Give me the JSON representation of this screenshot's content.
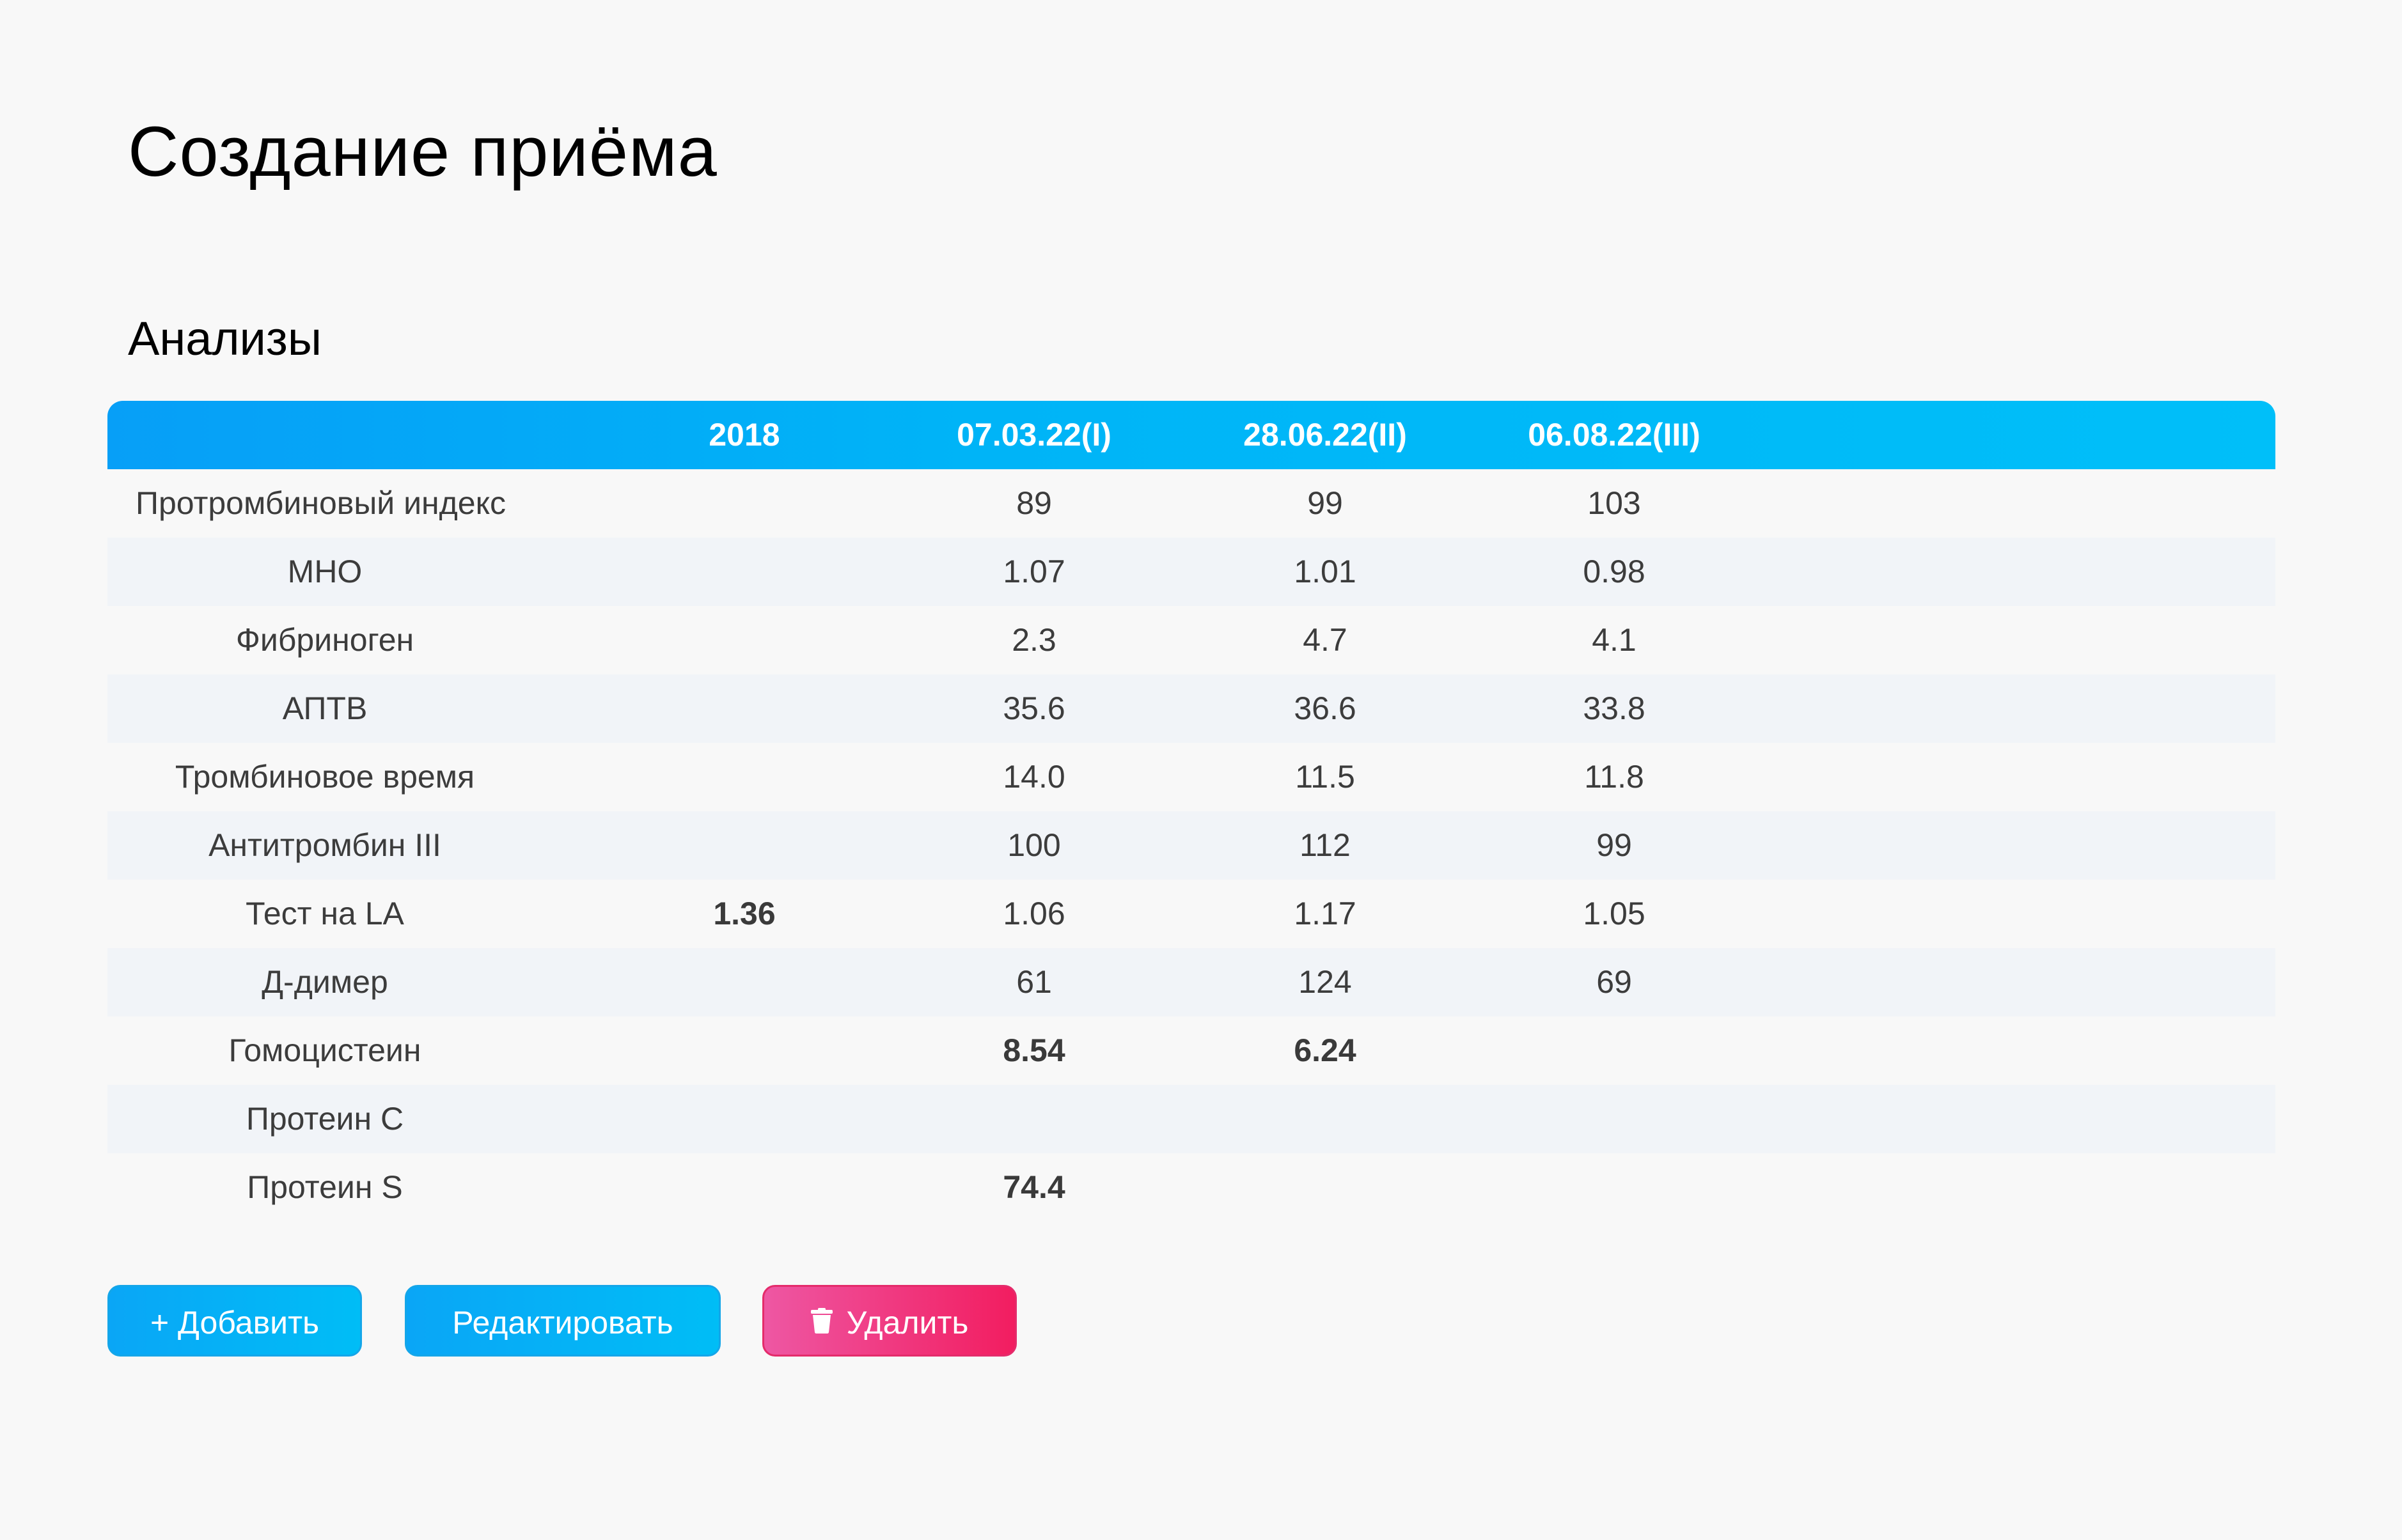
{
  "page": {
    "title": "Создание приёма"
  },
  "section": {
    "title": "Анализы"
  },
  "table": {
    "headers": [
      "",
      "2018",
      "07.03.22(I)",
      "28.06.22(II)",
      "06.08.22(III)"
    ],
    "rows": [
      {
        "name": "Протромбиновый индекс",
        "values": [
          "",
          "89",
          "99",
          "103"
        ]
      },
      {
        "name": "МНО",
        "values": [
          "",
          "1.07",
          "1.01",
          "0.98"
        ]
      },
      {
        "name": "Фибриноген",
        "values": [
          "",
          "2.3",
          "4.7",
          "4.1"
        ]
      },
      {
        "name": "АПТВ",
        "values": [
          "",
          "35.6",
          "36.6",
          "33.8"
        ]
      },
      {
        "name": "Тромбиновое время",
        "values": [
          "",
          "14.0",
          "11.5",
          "11.8"
        ]
      },
      {
        "name": "Антитромбин III",
        "values": [
          "",
          "100",
          "112",
          "99"
        ]
      },
      {
        "name": "Тест на LA",
        "values": [
          "1.36",
          "1.06",
          "1.17",
          "1.05"
        ]
      },
      {
        "name": "Д-димер",
        "values": [
          "",
          "61",
          "124",
          "69"
        ]
      },
      {
        "name": "Гомоцистеин",
        "values": [
          "",
          "8.54",
          "6.24",
          ""
        ]
      },
      {
        "name": "Протеин С",
        "values": [
          "",
          "",
          "",
          ""
        ]
      },
      {
        "name": "Протеин S",
        "values": [
          "",
          "74.4",
          "",
          ""
        ]
      }
    ]
  },
  "buttons": {
    "add_label": "+ Добавить",
    "edit_label": "Редактировать",
    "delete_label": "Удалить",
    "delete_icon": "trash-icon"
  },
  "colors": {
    "accent": "#00b4f7",
    "danger": "#f21d60"
  }
}
